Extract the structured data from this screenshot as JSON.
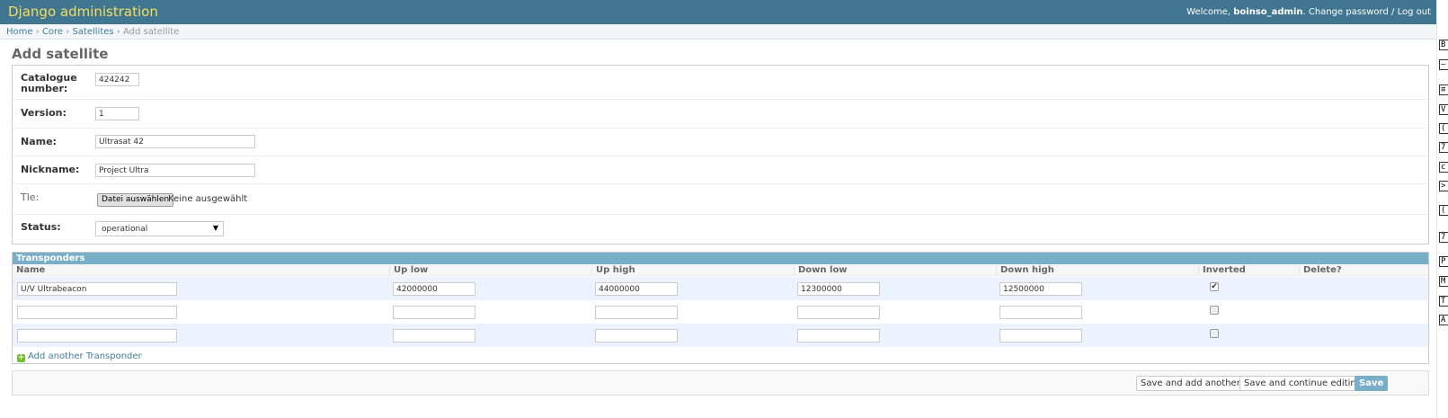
{
  "header": {
    "site_name": "Django administration",
    "welcome": "Welcome,",
    "username": "boinso_admin",
    "change_password": "Change password",
    "separator": "/",
    "logout": "Log out"
  },
  "breadcrumbs": {
    "home": "Home",
    "core": "Core",
    "satellites": "Satellites",
    "current": "Add satellite",
    "sep": "›"
  },
  "page_title": "Add satellite",
  "form": {
    "catalogue_label_line1": "Catalogue",
    "catalogue_label_line2": "number:",
    "catalogue_value": "424242",
    "version_label": "Version:",
    "version_value": "1",
    "name_label": "Name:",
    "name_value": "Ultrasat 42",
    "nickname_label": "Nickname:",
    "nickname_value": "Project Ultra",
    "tle_label": "Tle:",
    "tle_button": "Datei auswählen",
    "tle_status": "Keine ausgewählt",
    "status_label": "Status:",
    "status_value": "operational"
  },
  "transponders": {
    "caption": "Transponders",
    "columns": [
      "Name",
      "Up low",
      "Up high",
      "Down low",
      "Down high",
      "Inverted",
      "Delete?"
    ],
    "rows": [
      {
        "name": "U/V Ultrabeacon",
        "up_low": "42000000",
        "up_high": "44000000",
        "down_low": "12300000",
        "down_high": "12500000",
        "inverted": true
      },
      {
        "name": "",
        "up_low": "",
        "up_high": "",
        "down_low": "",
        "down_high": "",
        "inverted": false
      },
      {
        "name": "",
        "up_low": "",
        "up_high": "",
        "down_low": "",
        "down_high": "",
        "inverted": false
      }
    ],
    "add_another": "Add another Transponder",
    "add_icon": "plus-icon"
  },
  "submit": {
    "save_add_another": "Save and add another",
    "save_continue": "Save and continue editing",
    "save": "Save"
  },
  "side_strip": [
    "B",
    "—",
    "≡",
    "V",
    "(",
    "7",
    "c",
    ">",
    "(",
    "7",
    "P",
    "M",
    "T",
    "A"
  ],
  "colors": {
    "header_bg": "#417690",
    "brand": "#f5dd5d",
    "caption_bg": "#79aec8",
    "link": "#447e9b",
    "alt_row": "#edf3fe"
  }
}
